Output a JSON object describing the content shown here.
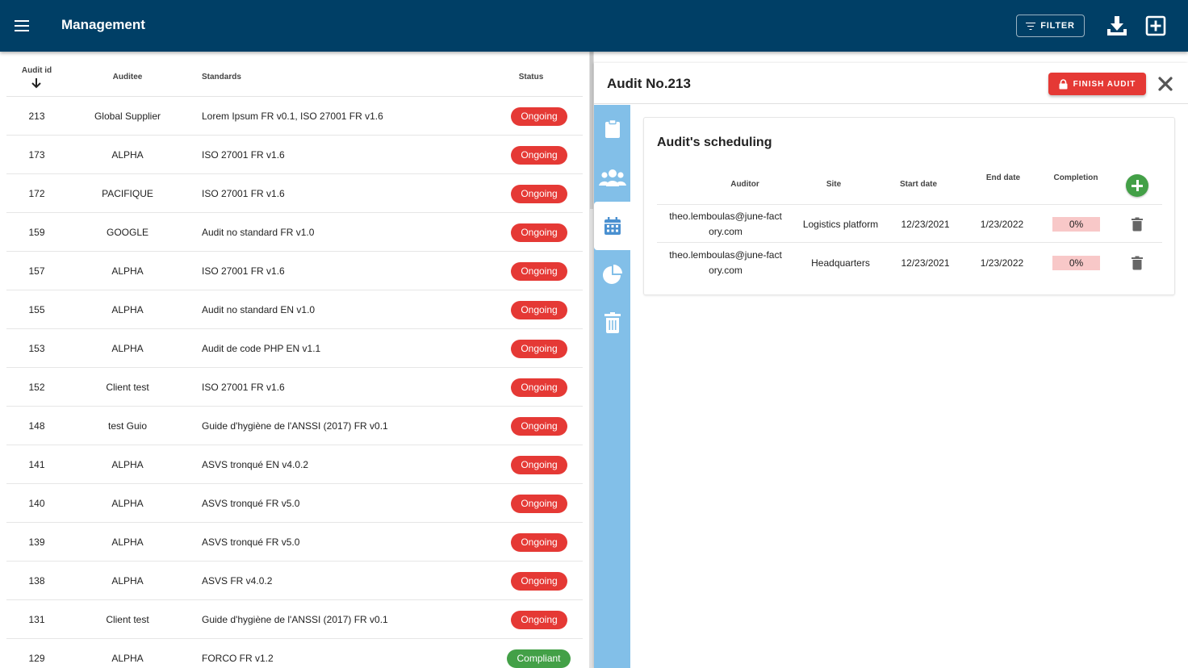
{
  "app": {
    "title": "Management",
    "filter_label": "FILTER",
    "accent": "#003f66"
  },
  "table": {
    "headers": {
      "id": "Audit id",
      "auditee": "Auditee",
      "standards": "Standards",
      "status": "Status"
    },
    "rows": [
      {
        "id": "213",
        "auditee": "Global Supplier",
        "standards": "Lorem Ipsum FR v0.1, ISO 27001 FR v1.6",
        "status": "Ongoing"
      },
      {
        "id": "173",
        "auditee": "ALPHA",
        "standards": "ISO 27001 FR v1.6",
        "status": "Ongoing"
      },
      {
        "id": "172",
        "auditee": "PACIFIQUE",
        "standards": "ISO 27001 FR v1.6",
        "status": "Ongoing"
      },
      {
        "id": "159",
        "auditee": "GOOGLE",
        "standards": "Audit no standard FR v1.0",
        "status": "Ongoing"
      },
      {
        "id": "157",
        "auditee": "ALPHA",
        "standards": "ISO 27001 FR v1.6",
        "status": "Ongoing"
      },
      {
        "id": "155",
        "auditee": "ALPHA",
        "standards": "Audit no standard EN v1.0",
        "status": "Ongoing"
      },
      {
        "id": "153",
        "auditee": "ALPHA",
        "standards": "Audit de code PHP EN v1.1",
        "status": "Ongoing"
      },
      {
        "id": "152",
        "auditee": "Client test",
        "standards": "ISO 27001 FR v1.6",
        "status": "Ongoing"
      },
      {
        "id": "148",
        "auditee": "test Guio",
        "standards": "Guide d'hygiène de l'ANSSI (2017) FR v0.1",
        "status": "Ongoing"
      },
      {
        "id": "141",
        "auditee": "ALPHA",
        "standards": "ASVS tronqué EN v4.0.2",
        "status": "Ongoing"
      },
      {
        "id": "140",
        "auditee": "ALPHA",
        "standards": "ASVS tronqué FR v5.0",
        "status": "Ongoing"
      },
      {
        "id": "139",
        "auditee": "ALPHA",
        "standards": "ASVS tronqué FR v5.0",
        "status": "Ongoing"
      },
      {
        "id": "138",
        "auditee": "ALPHA",
        "standards": "ASVS FR v4.0.2",
        "status": "Ongoing"
      },
      {
        "id": "131",
        "auditee": "Client test",
        "standards": "Guide d'hygiène de l'ANSSI (2017) FR v0.1",
        "status": "Ongoing"
      },
      {
        "id": "129",
        "auditee": "ALPHA",
        "standards": "FORCO FR v1.2",
        "status": "Compliant"
      }
    ]
  },
  "detail": {
    "title": "Audit No.213",
    "finish_label": "FINISH AUDIT",
    "card_title": "Audit's scheduling",
    "headers": {
      "auditor": "Auditor",
      "site": "Site",
      "start": "Start date",
      "end": "End date",
      "completion": "Completion"
    },
    "rows": [
      {
        "auditor": "theo.lemboulas@june-factory.com",
        "site": "Logistics platform",
        "start": "12/23/2021",
        "end": "1/23/2022",
        "completion": "0%"
      },
      {
        "auditor": "theo.lemboulas@june-factory.com",
        "site": "Headquarters",
        "start": "12/23/2021",
        "end": "1/23/2022",
        "completion": "0%"
      }
    ],
    "side_tabs": [
      "clipboard-icon",
      "people-icon",
      "calendar-icon",
      "pie-chart-icon",
      "trash-icon"
    ],
    "active_tab": "calendar-icon"
  }
}
